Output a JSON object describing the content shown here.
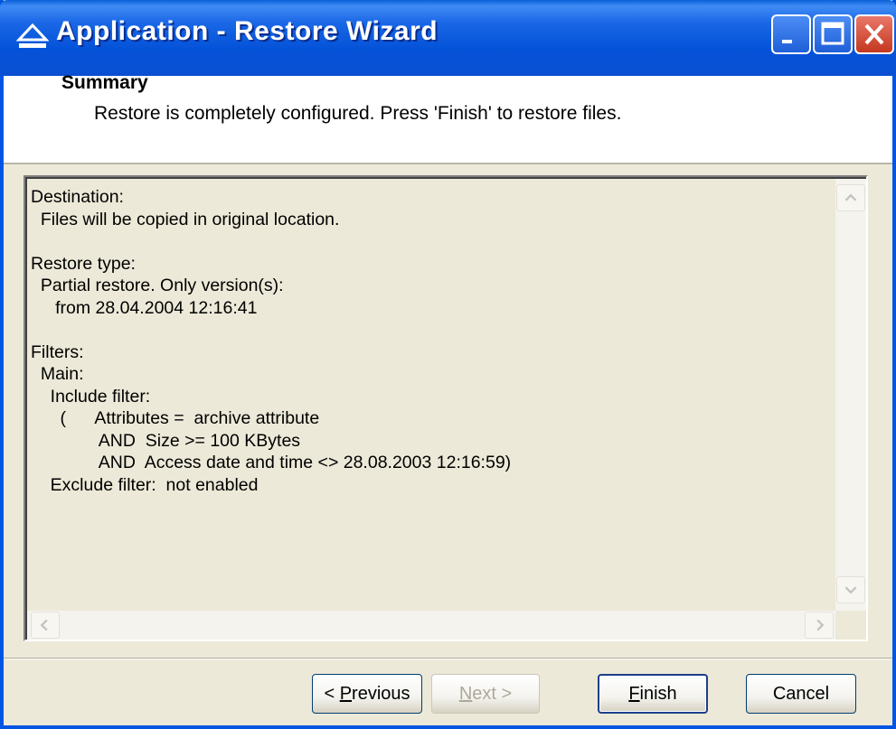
{
  "window": {
    "title": "Application - Restore Wizard",
    "icon": "eject-icon",
    "controls": [
      "minimize-icon",
      "maximize-icon",
      "close-icon"
    ]
  },
  "header": {
    "title": "Summary",
    "subtitle": "Restore is completely configured. Press 'Finish' to restore files."
  },
  "summary_lines": [
    "Destination:",
    "  Files will be copied in original location.",
    "",
    "Restore type:",
    "  Partial restore. Only version(s):",
    "     from 28.04.2004 12:16:41",
    "",
    "Filters:",
    "  Main:",
    "    Include filter:",
    "      (      Attributes =  archive attribute",
    "              AND  Size >= 100 KBytes",
    "              AND  Access date and time <> 28.08.2003 12:16:59)",
    "    Exclude filter:  not enabled"
  ],
  "buttons": {
    "previous": {
      "prefix": "< ",
      "mnemonic": "P",
      "rest": "revious"
    },
    "next": {
      "prefix": "",
      "mnemonic": "N",
      "rest": "ext >"
    },
    "finish": {
      "prefix": "",
      "mnemonic": "F",
      "rest": "inish"
    },
    "cancel": {
      "label": "Cancel"
    }
  },
  "colors": {
    "titlebar": "#0a4fd2",
    "close": "#c4381f",
    "face": "#ece9d8"
  }
}
